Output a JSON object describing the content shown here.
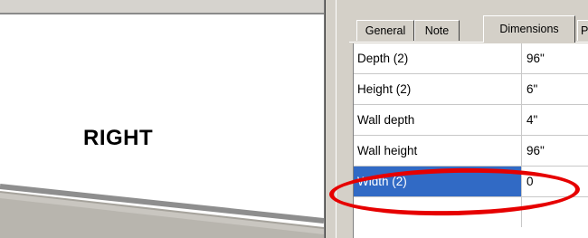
{
  "canvas": {
    "view_label": "RIGHT"
  },
  "property_panel": {
    "tabs": [
      {
        "label": "General",
        "active": false
      },
      {
        "label": "Note",
        "active": false
      },
      {
        "label": "Dimensions",
        "active": true
      },
      {
        "label": "Pr",
        "active": false
      }
    ],
    "properties": [
      {
        "name": "Depth (2)",
        "value": "96\"",
        "selected": false
      },
      {
        "name": "Height (2)",
        "value": "6\"",
        "selected": false
      },
      {
        "name": "Wall depth",
        "value": "4\"",
        "selected": false
      },
      {
        "name": "Wall height",
        "value": "96\"",
        "selected": false
      },
      {
        "name": "Width (2)",
        "value": "0",
        "selected": true
      }
    ]
  },
  "colors": {
    "selection": "#316ac5",
    "annotation": "#e60000",
    "panel_bg": "#d4d0c8"
  },
  "icons": []
}
